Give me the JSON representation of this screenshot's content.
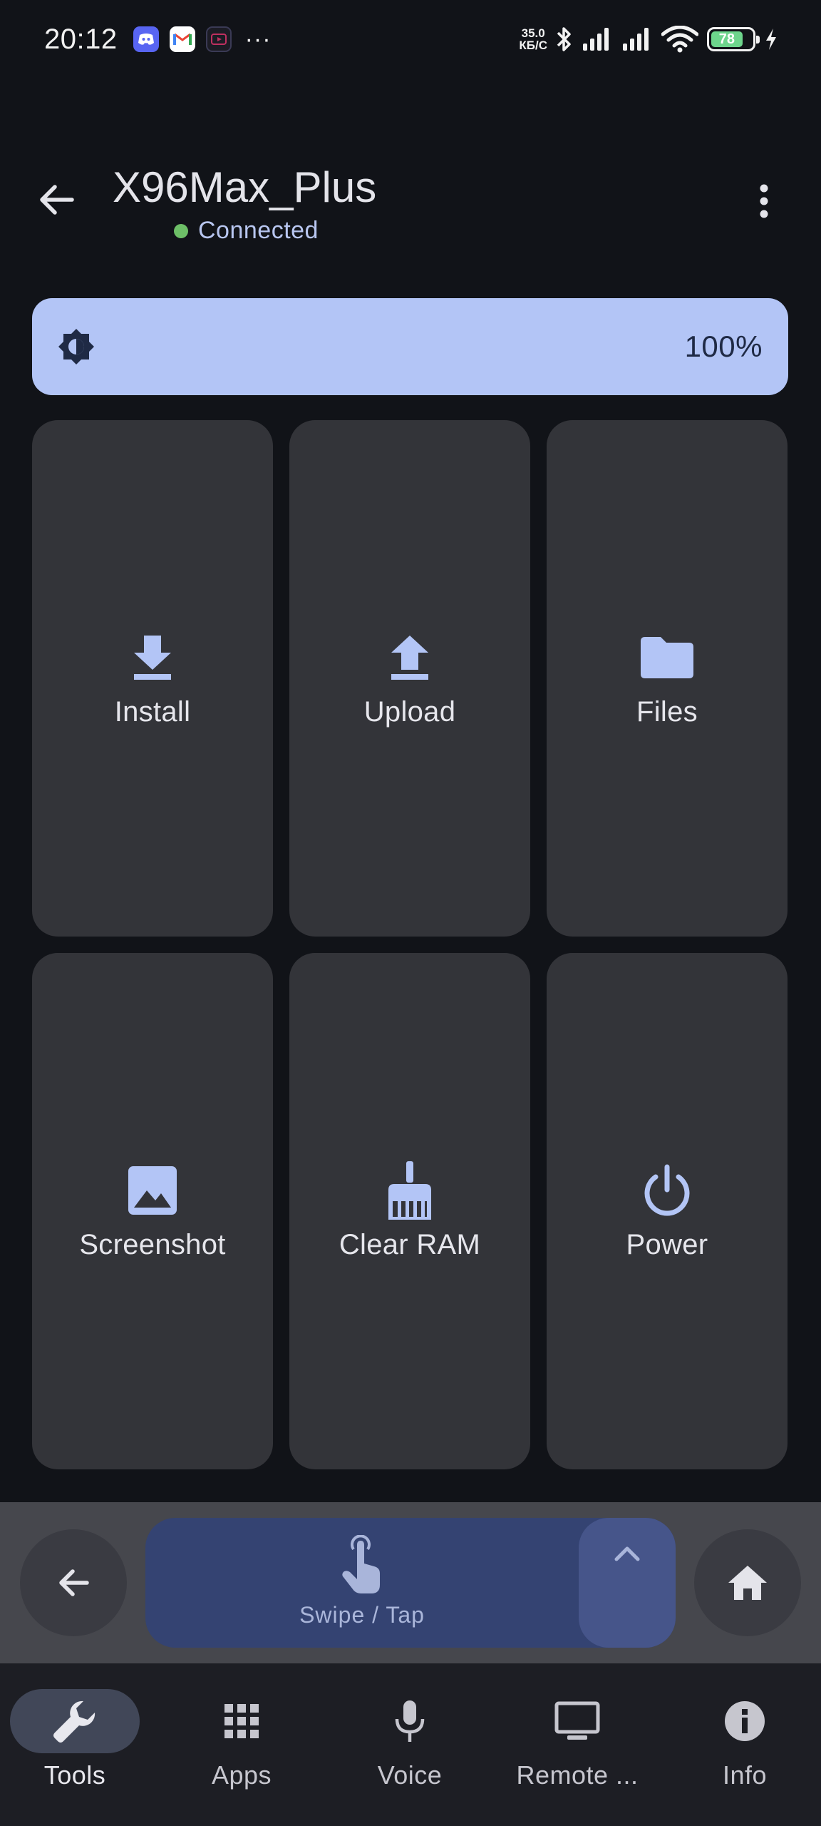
{
  "status_bar": {
    "time": "20:12",
    "notification_icons": [
      "discord-icon",
      "gmail-icon",
      "youtube-icon"
    ],
    "more": "···",
    "net_speed_value": "35.0",
    "net_speed_unit": "КБ/С",
    "battery": "78"
  },
  "header": {
    "title": "X96Max_Plus",
    "status": "Connected",
    "status_color": "#6dbf67"
  },
  "brightness": {
    "value": "100%",
    "level": 1.0,
    "color": "#b3c5f6"
  },
  "tools": [
    {
      "label": "Install",
      "icon": "download-icon"
    },
    {
      "label": "Upload",
      "icon": "upload-icon"
    },
    {
      "label": "Files",
      "icon": "folder-icon"
    },
    {
      "label": "Screenshot",
      "icon": "image-icon"
    },
    {
      "label": "Clear RAM",
      "icon": "broom-icon"
    },
    {
      "label": "Power",
      "icon": "power-icon"
    }
  ],
  "control": {
    "swipe_label": "Swipe / Tap",
    "left_button": "back-arrow-icon",
    "right_button": "home-icon",
    "expand": "chevron-up-icon"
  },
  "bottom_nav": [
    {
      "label": "Tools",
      "icon": "wrench-icon",
      "active": true
    },
    {
      "label": "Apps",
      "icon": "grid-icon",
      "active": false
    },
    {
      "label": "Voice",
      "icon": "mic-icon",
      "active": false
    },
    {
      "label": "Remote ...",
      "icon": "tv-icon",
      "active": false
    },
    {
      "label": "Info",
      "icon": "info-icon",
      "active": false
    }
  ],
  "colors": {
    "background": "#111318",
    "tile": "#333439",
    "accent": "#b3c5f6",
    "swipe_pad": "#344372"
  }
}
